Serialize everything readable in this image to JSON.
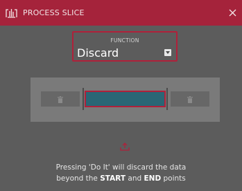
{
  "titlebar": {
    "title": "PROCESS SLICE",
    "logo_icon": "akai-logo-icon",
    "close_icon": "close-icon",
    "color": "#a5233b"
  },
  "function": {
    "label": "FUNCTION",
    "value": "Discard",
    "dropdown_icon": "chevron-down-icon"
  },
  "slice_panel": {
    "left_icon": "trash-icon",
    "right_icon": "trash-icon",
    "selection_color": "#2a6675"
  },
  "description": {
    "part1": "Pressing 'Do It' will discard the data",
    "part2": "beyond the ",
    "start": "START",
    "and": " and ",
    "end": "END",
    "part3": " points"
  },
  "colors": {
    "background": "#5c5c5c",
    "accent": "#b0203a"
  }
}
